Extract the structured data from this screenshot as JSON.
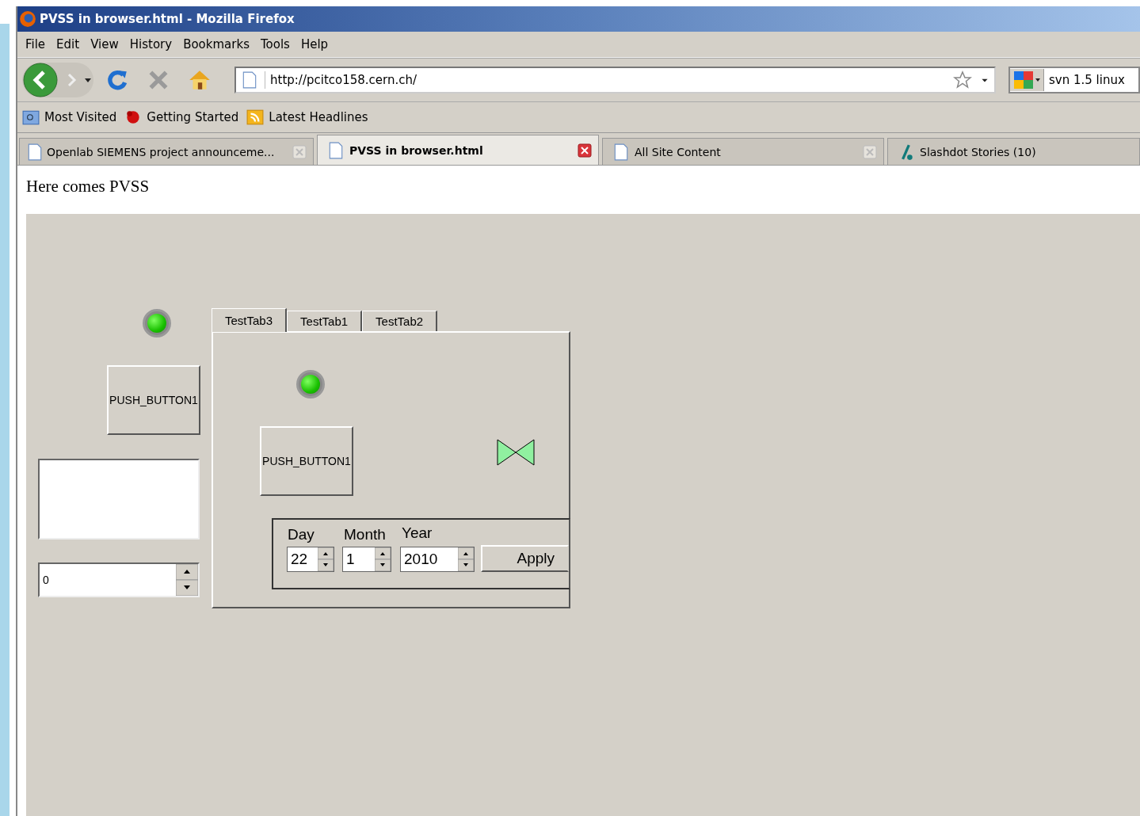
{
  "window": {
    "title": "PVSS in browser.html - Mozilla Firefox"
  },
  "menu": [
    "File",
    "Edit",
    "View",
    "History",
    "Bookmarks",
    "Tools",
    "Help"
  ],
  "toolbar": {
    "url": "http://pcitco158.cern.ch/",
    "search_value": "svn 1.5 linux"
  },
  "bookmarks": [
    {
      "label": "Most Visited",
      "kind": "folder"
    },
    {
      "label": "Getting Started",
      "kind": "bug"
    },
    {
      "label": "Latest Headlines",
      "kind": "feed"
    }
  ],
  "tabs": [
    {
      "label": "Openlab SIEMENS project announceme...",
      "selected": false,
      "kind": "page"
    },
    {
      "label": "PVSS in browser.html",
      "selected": true,
      "kind": "page"
    },
    {
      "label": "All Site Content",
      "selected": false,
      "kind": "page"
    },
    {
      "label": "Slashdot Stories (10)",
      "selected": false,
      "kind": "slashdot"
    }
  ],
  "page": {
    "heading": "Here comes PVSS",
    "panel": {
      "led_on": true,
      "button": "PUSH_BUTTON1",
      "spin_value": "0",
      "tab_widget": {
        "tabs": [
          {
            "label": "TestTab3",
            "selected": true
          },
          {
            "label": "TestTab1",
            "selected": false
          },
          {
            "label": "TestTab2",
            "selected": false
          }
        ],
        "led_on": true,
        "button": "PUSH_BUTTON1",
        "date": {
          "day_label": "Day",
          "month_label": "Month",
          "year_label": "Year",
          "day": "22",
          "month": "1",
          "year": "2010",
          "apply": "Apply"
        }
      }
    }
  }
}
